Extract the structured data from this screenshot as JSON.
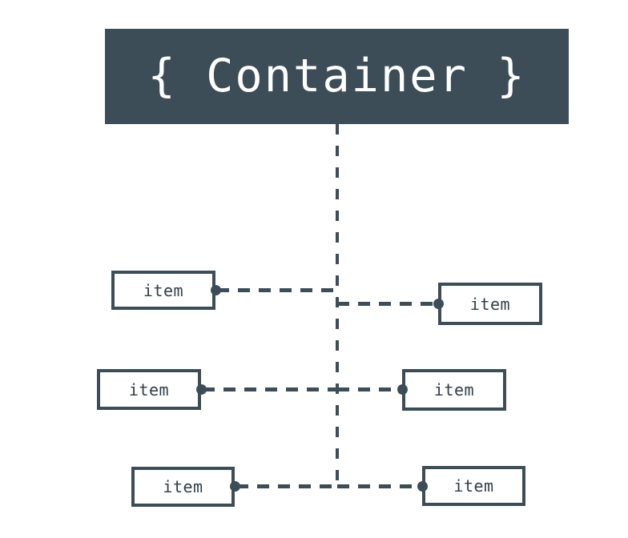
{
  "diagram": {
    "type": "container-items-relationship-diagram",
    "background_color": "#ffffff",
    "accent_color": "#3c4d57",
    "container": {
      "label": "{ Container }",
      "fill_color": "#3c4d57",
      "text_color": "#ffffff"
    },
    "spine": {
      "name": "vertical-dashed-spine",
      "style": "dashed"
    },
    "rows": [
      {
        "left_item": {
          "label": "item"
        },
        "right_item": {
          "label": "item"
        }
      },
      {
        "left_item": {
          "label": "item"
        },
        "right_item": {
          "label": "item"
        }
      },
      {
        "left_item": {
          "label": "item"
        },
        "right_item": {
          "label": "item"
        }
      }
    ]
  }
}
